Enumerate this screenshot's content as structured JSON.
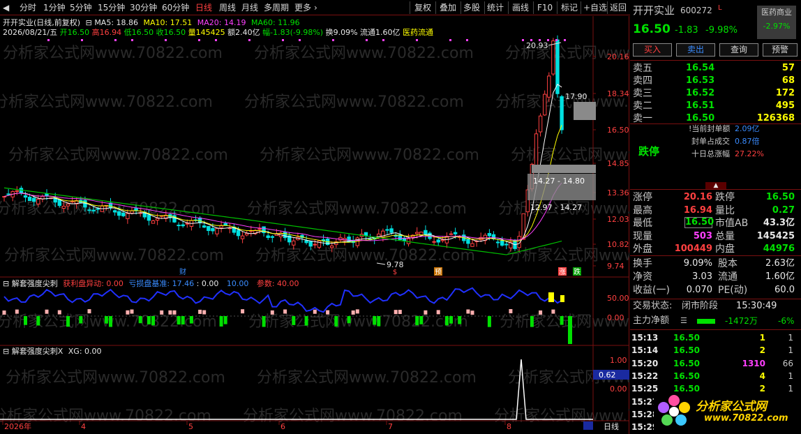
{
  "toolbar": {
    "periods": [
      "分时",
      "1分钟",
      "5分钟",
      "15分钟",
      "30分钟",
      "60分钟",
      "日线",
      "周线",
      "月线",
      "多周期",
      "更多"
    ],
    "active_period": "日线",
    "tools": [
      "复权",
      "叠加",
      "多股",
      "统计",
      "画线",
      "F10",
      "标记",
      "+自选",
      "返回"
    ]
  },
  "stock": {
    "title": "开开实业(日线,前复权)",
    "name": "开开实业",
    "code": "600272",
    "badge": "L",
    "sector": "医药商业",
    "sector_change": "-2.97%",
    "price": "16.50",
    "change": "-1.83",
    "change_pct": "-9.98%"
  },
  "ma_line": {
    "ma5": "MA5: 18.86",
    "ma10": "MA10: 17.51",
    "ma20": "MA20: 14.19",
    "ma60": "MA60: 11.96"
  },
  "ohlc_line": {
    "date": "2026/08/21/五",
    "open": "开16.50",
    "high": "高16.94",
    "low": "低16.50",
    "close": "收16.50",
    "volume": "量145425",
    "amount": "额2.40亿",
    "range": "幅-1.83(-9.98%)",
    "turnover": "换9.09%",
    "float": "流通1.60亿",
    "tag": "医药流通"
  },
  "price_axis": [
    "20.16",
    "18.34",
    "16.50",
    "14.85",
    "13.36",
    "12.03",
    "10.82",
    "9.74"
  ],
  "annotations": {
    "high_mark": "20.93",
    "low_mark": "9.78",
    "box_top": "17.90",
    "range1": "14.27 - 14.80",
    "range2": "12.97 - 14.27",
    "tag_cai": "财",
    "tag_s": "$",
    "tag_yu": "预",
    "tag_zhang": "涨",
    "tag_die": "跌"
  },
  "ind1": {
    "name": "解套强度尖刺",
    "profit": "获利盘异动: 0.00",
    "loss": "亏损盘基准: 17.46",
    "val3": ": 0.00",
    "val4": "10.00",
    "param": "参数: 40.00",
    "axis": [
      "50.00",
      "0.00"
    ]
  },
  "ind2": {
    "name": "解套强度尖刺X",
    "xg": "XG: 0.00",
    "axis": [
      "1.00",
      "0.62",
      "0.00"
    ]
  },
  "date_axis": [
    "2026年",
    "4",
    "5",
    "6",
    "7",
    "8"
  ],
  "bottom_tab": "日线",
  "trade": {
    "buttons": [
      "买入",
      "卖出",
      "查询",
      "预警"
    ],
    "asks": [
      {
        "label": "卖五",
        "price": "16.54",
        "vol": "57"
      },
      {
        "label": "卖四",
        "price": "16.53",
        "vol": "68"
      },
      {
        "label": "卖三",
        "price": "16.52",
        "vol": "172"
      },
      {
        "label": "卖二",
        "price": "16.51",
        "vol": "495"
      },
      {
        "label": "卖一",
        "price": "16.50",
        "vol": "126368"
      }
    ],
    "limit_status": "跌停",
    "seal_amount_label": "当前封单额",
    "seal_amount": "2.09亿",
    "seal_ratio_label": "封单占成交",
    "seal_ratio": "0.87倍",
    "ten_day_label": "十日总涨幅",
    "ten_day": "27.22%"
  },
  "stats": [
    {
      "l1": "涨停",
      "v1": "20.16",
      "l2": "跌停",
      "v2": "16.50"
    },
    {
      "l1": "最高",
      "v1": "16.94",
      "l2": "量比",
      "v2": "0.27"
    },
    {
      "l1": "最低",
      "v1": "16.50",
      "l2": "市值AB",
      "v2": "43.3亿"
    },
    {
      "l1": "现量",
      "v1": "503",
      "l2": "总量",
      "v2": "145425"
    },
    {
      "l1": "外盘",
      "v1": "100449",
      "l2": "内盘",
      "v2": "44976"
    }
  ],
  "fin": [
    {
      "l1": "换手",
      "v1": "9.09%",
      "l2": "股本",
      "v2": "2.63亿"
    },
    {
      "l1": "净资",
      "v1": "3.03",
      "l2": "流通",
      "v2": "1.60亿"
    },
    {
      "l1": "收益(一)",
      "v1": "0.070",
      "l2": "PE(动)",
      "v2": "60.0"
    }
  ],
  "market_state": {
    "label": "交易状态:",
    "value": "闭市阶段",
    "time": "15:30:49"
  },
  "main_flow": {
    "label": "主力净额",
    "value": "-1472万",
    "pct": "-6%"
  },
  "ticks": [
    {
      "t": "15:13",
      "p": "16.50",
      "v": "1",
      "n": "1"
    },
    {
      "t": "15:14",
      "p": "16.50",
      "v": "2",
      "n": "1"
    },
    {
      "t": "15:20",
      "p": "16.50",
      "v": "1310",
      "n": "66"
    },
    {
      "t": "15:22",
      "p": "16.50",
      "v": "4",
      "n": "1"
    },
    {
      "t": "15:25",
      "p": "16.50",
      "v": "2",
      "n": "1"
    },
    {
      "t": "15:27",
      "p": "",
      "v": "",
      "n": ""
    },
    {
      "t": "15:28",
      "p": "",
      "v": "",
      "n": ""
    },
    {
      "t": "15:29",
      "p": "",
      "v": "",
      "n": ""
    }
  ],
  "logo": {
    "text": "分析家公式网",
    "url": "www.70822.com"
  },
  "watermark": "分析家公式网www.70822.com",
  "colors": {
    "up": "#ff4040",
    "down": "#00e0e0",
    "ma5": "#ffffff",
    "ma10": "#ffff00",
    "ma20": "#ff40ff",
    "ma60": "#00c000",
    "border": "#7a1010"
  }
}
